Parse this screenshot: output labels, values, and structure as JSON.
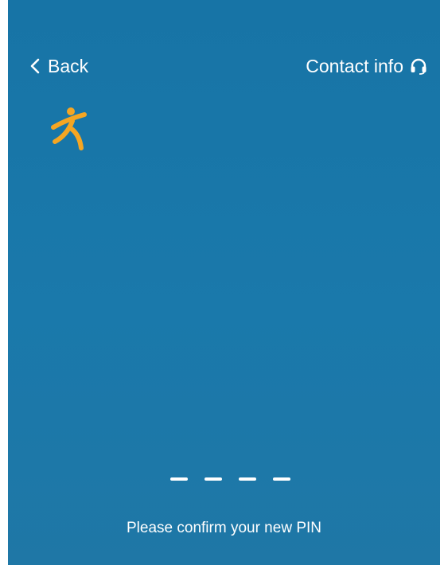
{
  "header": {
    "back_label": "Back",
    "contact_label": "Contact info",
    "back_icon": "chevron-left-icon",
    "contact_icon": "headset-icon"
  },
  "logo": {
    "icon": "person-logo-icon",
    "color": "#f5a623"
  },
  "pin": {
    "length": 4,
    "entered": 0,
    "prompt": "Please confirm your new PIN"
  },
  "colors": {
    "background": "#1a77a8",
    "text": "#ffffff",
    "accent": "#f5a623"
  }
}
